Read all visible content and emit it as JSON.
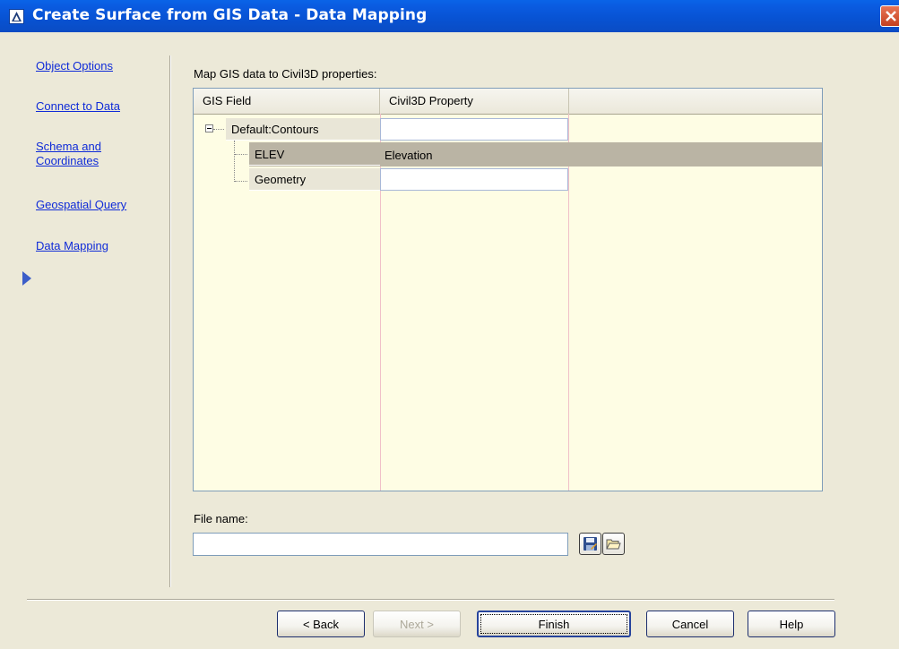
{
  "window": {
    "title": "Create Surface from GIS Data - Data Mapping"
  },
  "sidebar": {
    "items": [
      {
        "label": "Object Options"
      },
      {
        "label": "Connect to Data"
      },
      {
        "label": "Schema and Coordinates"
      },
      {
        "label": "Geospatial Query"
      },
      {
        "label": "Data Mapping",
        "active": true
      }
    ]
  },
  "main": {
    "map_label": "Map GIS data to Civil3D properties:",
    "grid": {
      "columns": [
        "GIS Field",
        "Civil3D Property"
      ],
      "rows": [
        {
          "field": "Default:Contours",
          "property": "",
          "level": 0,
          "expanded": true
        },
        {
          "field": "ELEV",
          "property": "Elevation",
          "level": 1,
          "selected": true
        },
        {
          "field": "Geometry",
          "property": "",
          "level": 1
        }
      ]
    },
    "file": {
      "label": "File name:",
      "value": ""
    }
  },
  "buttons": {
    "back": "< Back",
    "next": "Next >",
    "finish": "Finish",
    "cancel": "Cancel",
    "help": "Help"
  },
  "colors": {
    "titlebar": "#0a5be0",
    "link": "#0f2bd8",
    "grid_background": "#fefde4",
    "selected_row": "#bab4a4"
  },
  "icons": {
    "title": "civil3d-app-icon",
    "close": "close-icon",
    "save": "save-icon",
    "open": "open-folder-icon",
    "active_step": "arrow-right-icon"
  }
}
